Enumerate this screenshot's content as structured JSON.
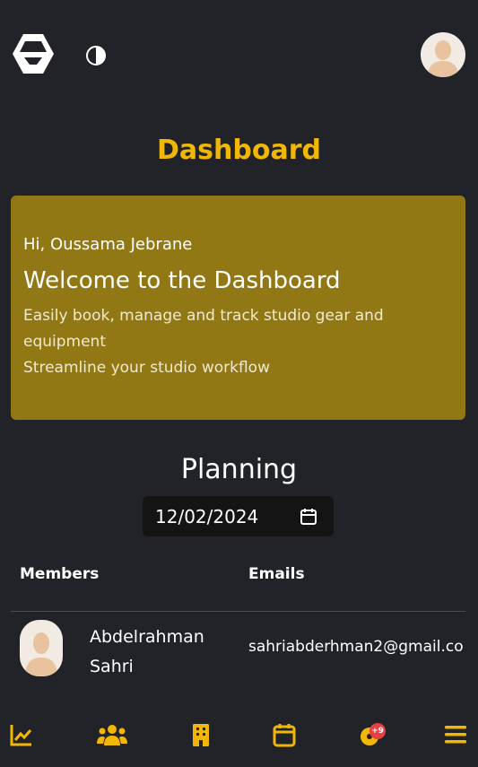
{
  "header": {
    "logo_icon": "shield-logo-icon",
    "theme_icon": "contrast-toggle-icon",
    "avatar_icon": "user-avatar-icon"
  },
  "page_title": "Dashboard",
  "welcome": {
    "greeting": "Hi, Oussama Jebrane",
    "title": "Welcome to the Dashboard",
    "line1": "Easily book, manage and track studio gear and equipment",
    "line2": "Streamline your studio workflow"
  },
  "planning": {
    "title": "Planning",
    "date_value": "12/02/2024"
  },
  "table": {
    "columns": [
      "Members",
      "Emails"
    ],
    "rows": [
      {
        "name": "Abdelrahman Sahri",
        "email": "sahriabderhman2@gmail.co"
      }
    ]
  },
  "bottom_nav": {
    "items": [
      "chart-line-icon",
      "users-icon",
      "building-icon",
      "calendar-icon",
      "notification-icon",
      "menu-icon"
    ],
    "badge": "+9"
  },
  "colors": {
    "background": "#212328",
    "accent": "#f2b705",
    "card": "#927814",
    "badge": "#e84040"
  }
}
